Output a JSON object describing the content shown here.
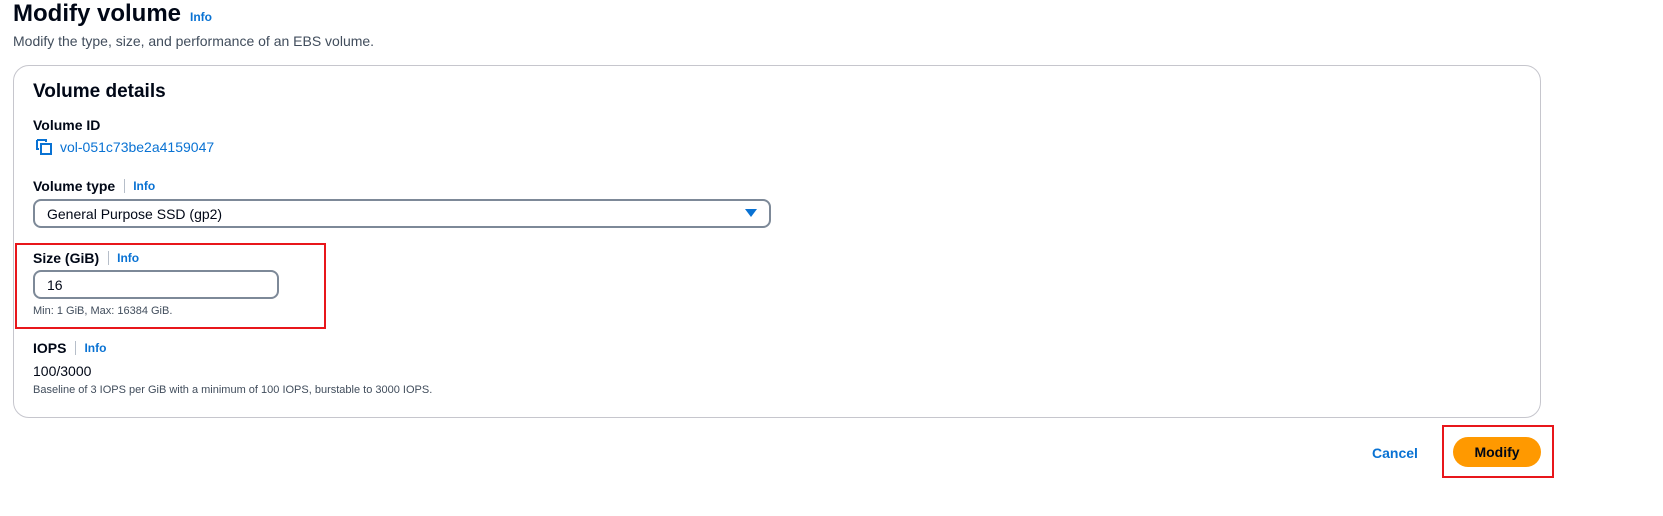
{
  "header": {
    "title": "Modify volume",
    "info": "Info",
    "description": "Modify the type, size, and performance of an EBS volume."
  },
  "volume_details": {
    "section_title": "Volume details",
    "volume_id": {
      "label": "Volume ID",
      "value": "vol-051c73be2a4159047",
      "icon": "copy-icon"
    },
    "volume_type": {
      "label": "Volume type",
      "info": "Info",
      "selected": "General Purpose SSD (gp2)"
    },
    "size": {
      "label": "Size (GiB)",
      "info": "Info",
      "value": "16",
      "hint": "Min: 1 GiB, Max: 16384 GiB."
    },
    "iops": {
      "label": "IOPS",
      "info": "Info",
      "value": "100/3000",
      "hint": "Baseline of 3 IOPS per GiB with a minimum of 100 IOPS, burstable to 3000 IOPS."
    }
  },
  "actions": {
    "cancel": "Cancel",
    "modify": "Modify"
  },
  "colors": {
    "link": "#0972d3",
    "primary_button": "#ff9900",
    "highlight": "#e8161b"
  }
}
